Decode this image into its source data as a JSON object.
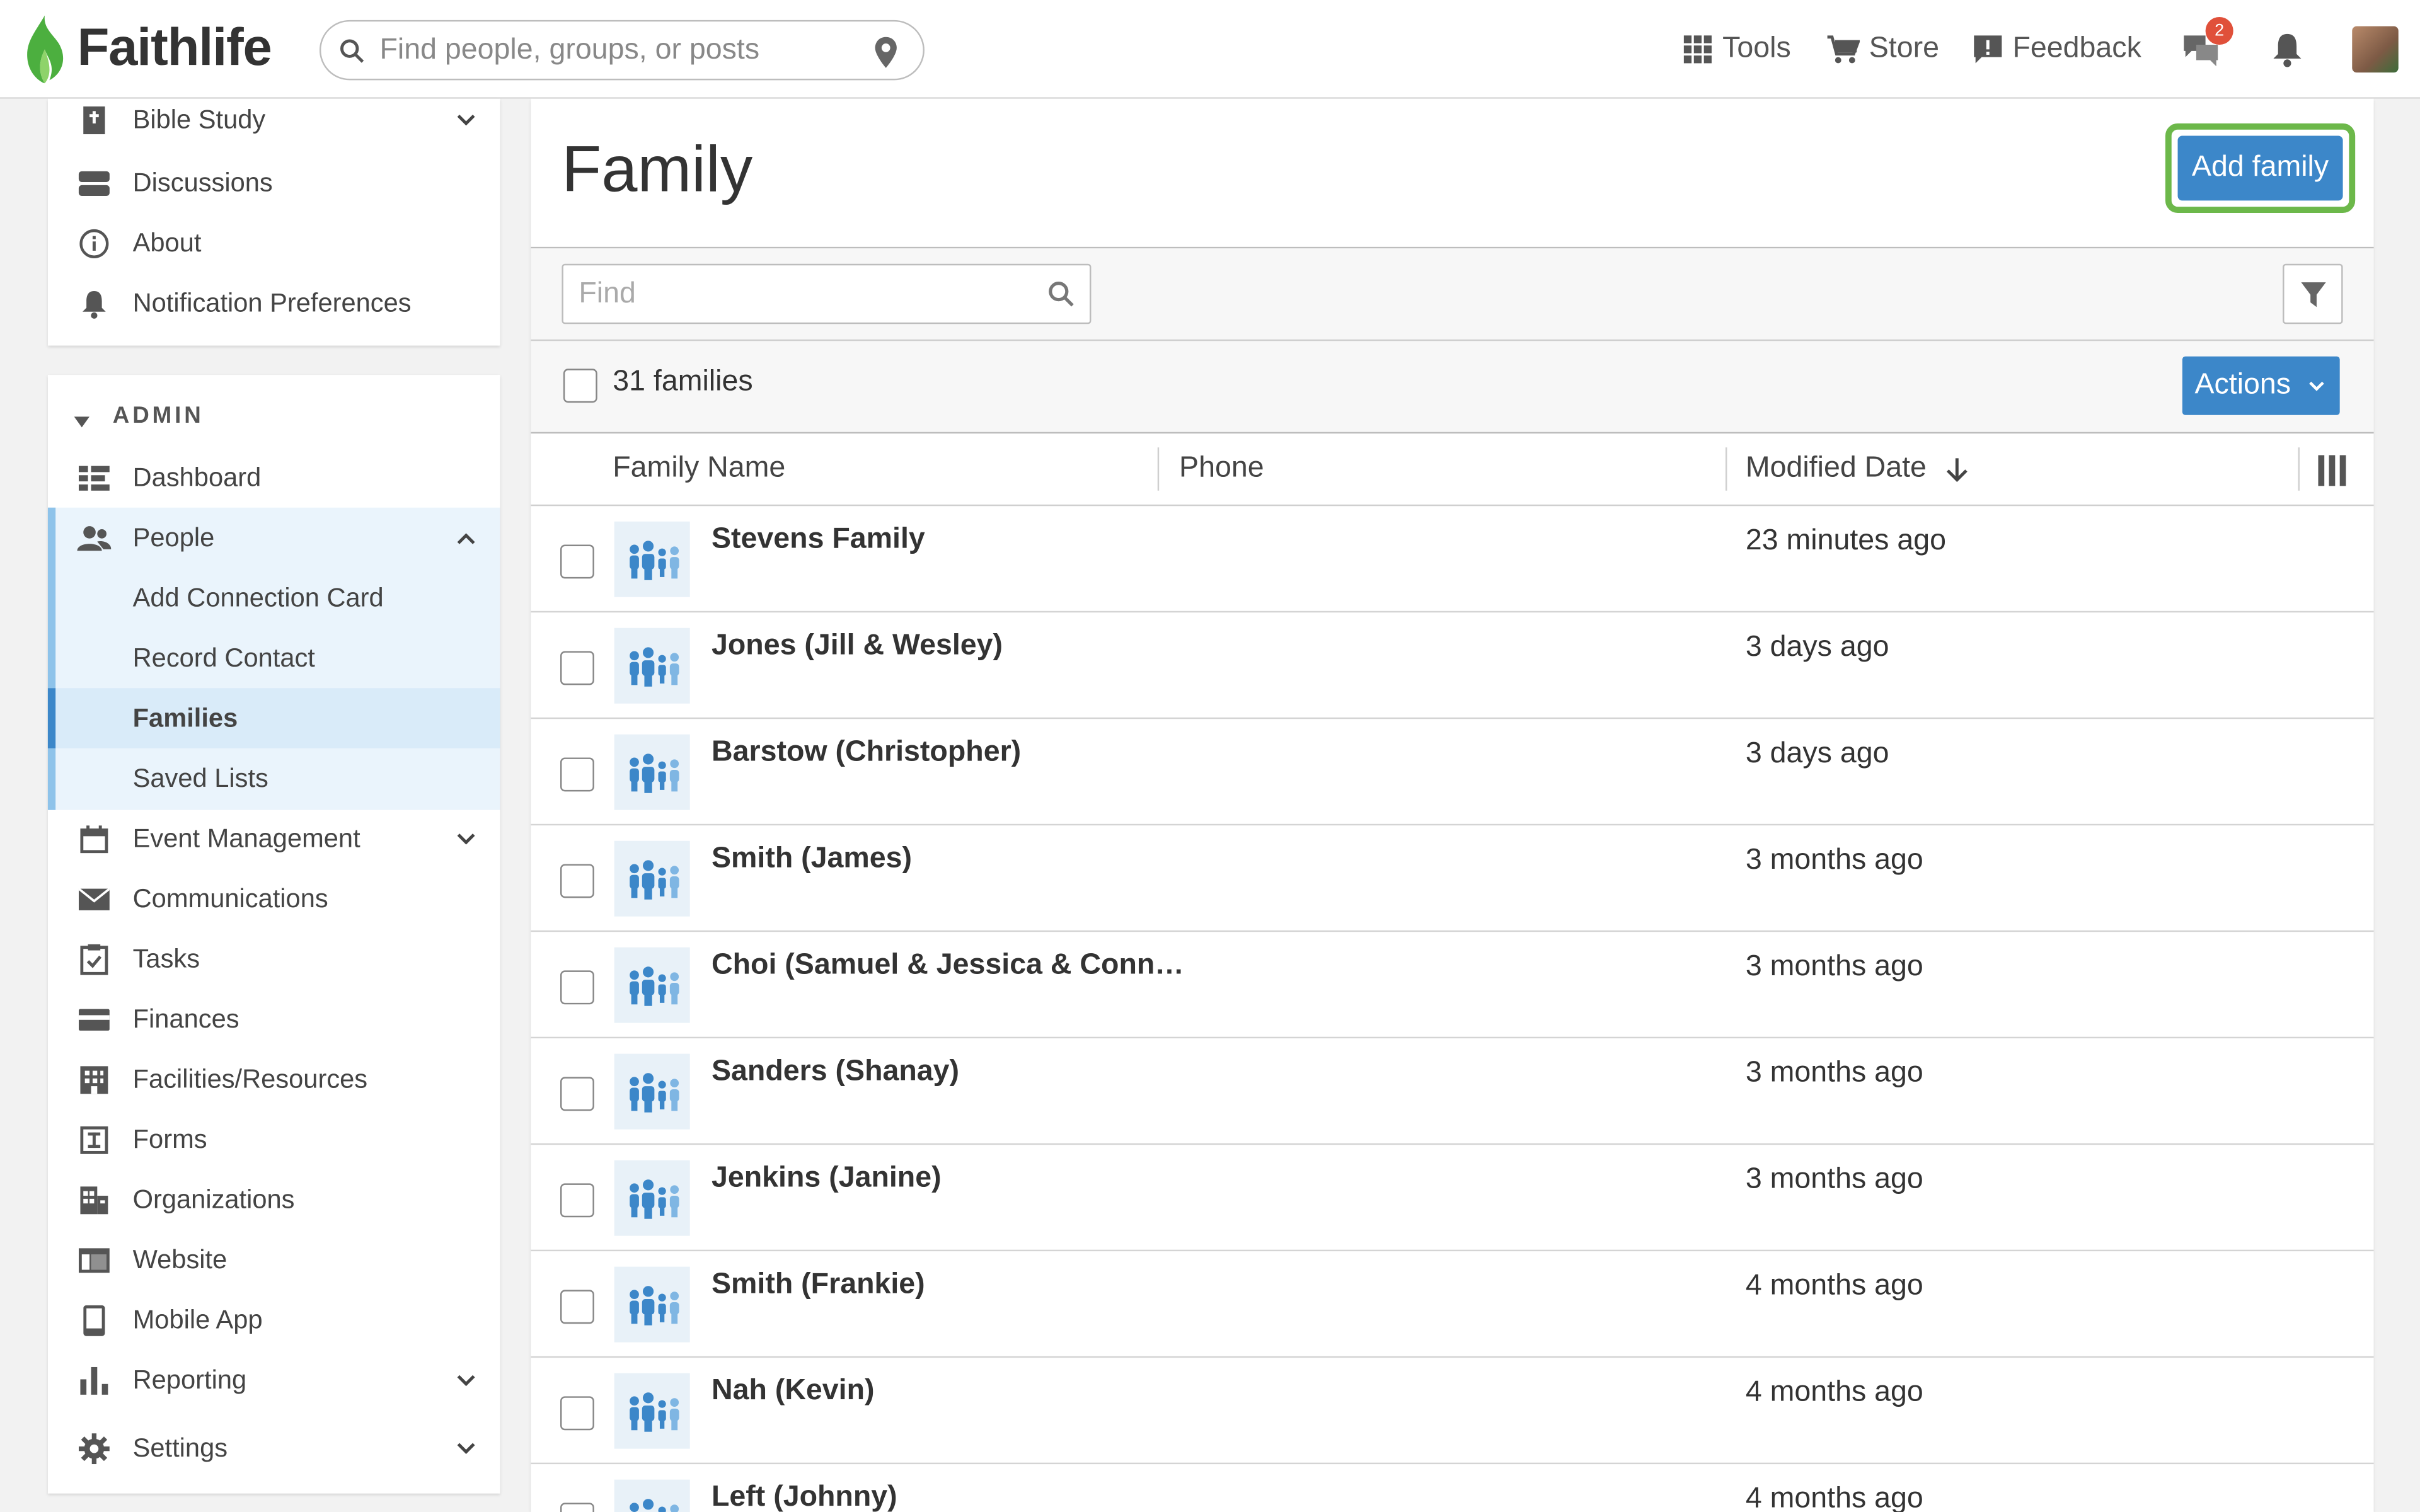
{
  "app": {
    "brand": "Faithlife"
  },
  "search": {
    "placeholder": "Find people, groups, or posts"
  },
  "topnav": {
    "tools": "Tools",
    "store": "Store",
    "feedback": "Feedback",
    "messages_badge": "2"
  },
  "sidebar": {
    "top_items": [
      {
        "label": "Bible Study",
        "icon": "book-icon"
      },
      {
        "label": "Discussions",
        "icon": "chat-bubbles-icon"
      },
      {
        "label": "About",
        "icon": "info-icon"
      },
      {
        "label": "Notification Preferences",
        "icon": "bell-icon"
      }
    ],
    "admin_heading": "ADMIN",
    "admin_items": [
      {
        "label": "Dashboard",
        "icon": "dashboard-icon"
      },
      {
        "label": "People",
        "icon": "people-icon"
      },
      {
        "label": "Add Connection Card"
      },
      {
        "label": "Record Contact"
      },
      {
        "label": "Families"
      },
      {
        "label": "Saved Lists"
      },
      {
        "label": "Event Management",
        "icon": "calendar-icon"
      },
      {
        "label": "Communications",
        "icon": "envelope-icon"
      },
      {
        "label": "Tasks",
        "icon": "clipboard-check-icon"
      },
      {
        "label": "Finances",
        "icon": "credit-card-icon"
      },
      {
        "label": "Facilities/Resources",
        "icon": "building-icon"
      },
      {
        "label": "Forms",
        "icon": "form-icon"
      },
      {
        "label": "Organizations",
        "icon": "organization-icon"
      },
      {
        "label": "Website",
        "icon": "website-icon"
      },
      {
        "label": "Mobile App",
        "icon": "mobile-icon"
      },
      {
        "label": "Reporting",
        "icon": "bar-chart-icon"
      },
      {
        "label": "Settings",
        "icon": "gear-icon"
      }
    ]
  },
  "main": {
    "title": "Family",
    "add_button": "Add family",
    "find_placeholder": "Find",
    "count_label": "31 families",
    "actions_label": "Actions",
    "columns": {
      "name": "Family Name",
      "phone": "Phone",
      "modified": "Modified Date"
    },
    "rows": [
      {
        "name": "Stevens Family",
        "modified": "23 minutes ago"
      },
      {
        "name": "Jones (Jill & Wesley)",
        "modified": "3 days ago"
      },
      {
        "name": "Barstow (Christopher)",
        "modified": "3 days ago"
      },
      {
        "name": "Smith (James)",
        "modified": "3 months ago"
      },
      {
        "name": "Choi (Samuel & Jessica & Conn…",
        "modified": "3 months ago"
      },
      {
        "name": "Sanders (Shanay)",
        "modified": "3 months ago"
      },
      {
        "name": "Jenkins (Janine)",
        "modified": "3 months ago"
      },
      {
        "name": "Smith (Frankie)",
        "modified": "4 months ago"
      },
      {
        "name": "Nah (Kevin)",
        "modified": "4 months ago"
      },
      {
        "name": "Left (Johnny)",
        "modified": "4 months ago"
      }
    ]
  },
  "colors": {
    "accent": "#3c87c9",
    "highlight": "#6cb84a",
    "brand_green": "#4caf3f"
  }
}
